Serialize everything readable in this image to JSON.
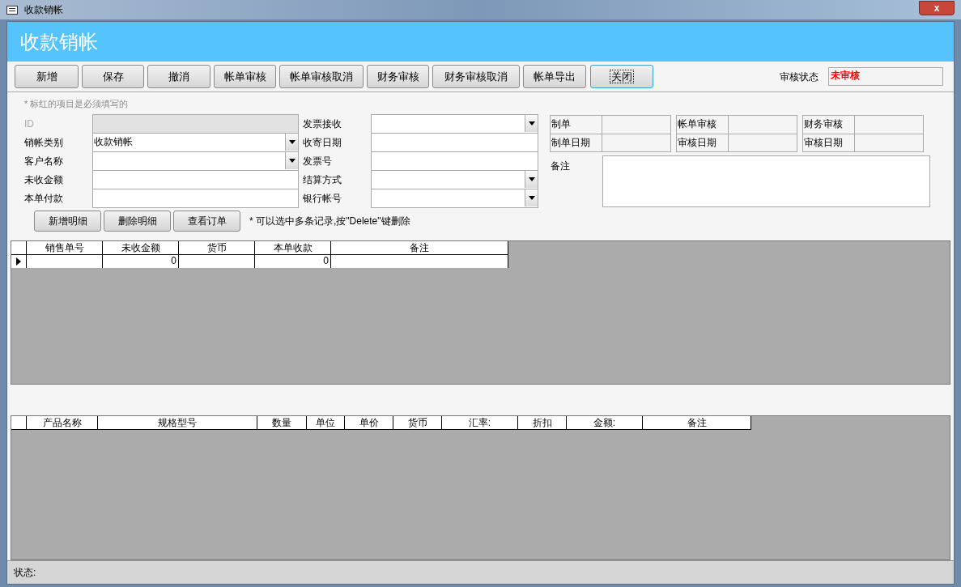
{
  "window": {
    "title": "收款销帐",
    "close": "x"
  },
  "header": {
    "title": "收款销帐"
  },
  "toolbar": {
    "buttons": [
      {
        "label": "新增",
        "focused": false
      },
      {
        "label": "保存",
        "focused": false
      },
      {
        "label": "撤消",
        "focused": false
      },
      {
        "label": "帐单审核",
        "focused": false
      },
      {
        "label": "帐单审核取消",
        "focused": false
      },
      {
        "label": "财务审核",
        "focused": false
      },
      {
        "label": "财务审核取消",
        "focused": false
      },
      {
        "label": "帐单导出",
        "focused": false
      },
      {
        "label": "关闭",
        "focused": true
      }
    ],
    "status_label": "审核状态",
    "status_value": "未审核"
  },
  "form": {
    "note": "* 标红的项目是必须填写的",
    "left_fields": [
      {
        "label": "ID",
        "kind": "text",
        "disabled": true
      },
      {
        "label": "销帐类别",
        "kind": "combo",
        "value": "收款销帐",
        "disabled": false
      },
      {
        "label": "客户名称",
        "kind": "combo",
        "disabled": false
      },
      {
        "label": "未收金额",
        "kind": "text",
        "disabled": false
      },
      {
        "label": "本单付款",
        "kind": "text",
        "disabled": false
      }
    ],
    "middle_fields": [
      {
        "label": "发票接收",
        "kind": "combo",
        "disabled": false
      },
      {
        "label": "收寄日期",
        "kind": "text",
        "disabled": false
      },
      {
        "label": "发票号",
        "kind": "text",
        "disabled": false
      },
      {
        "label": "结算方式",
        "kind": "combo",
        "disabled": false
      },
      {
        "label": "银行帐号",
        "kind": "combo",
        "disabled": false
      }
    ],
    "audit_groups": [
      [
        {
          "label": "制单"
        },
        {
          "label": "制单日期"
        }
      ],
      [
        {
          "label": "帐单审核"
        },
        {
          "label": "审核日期"
        }
      ],
      [
        {
          "label": "财务审核"
        },
        {
          "label": "审核日期"
        }
      ]
    ],
    "remarks_label": "备注",
    "detail_buttons": [
      "新增明细",
      "删除明细",
      "查看订单"
    ],
    "detail_hint": "* 可以选中多条记录,按\"Delete\"键删除"
  },
  "payment_table": {
    "columns": [
      "销售单号",
      "未收金额",
      "货币",
      "本单收款",
      "备注"
    ],
    "rows": [
      {
        "selected": true,
        "cells": [
          "",
          "0",
          "",
          "0",
          ""
        ]
      }
    ]
  },
  "product_table": {
    "columns": [
      "产品名称",
      "规格型号",
      "数量",
      "单位",
      "单价",
      "货币",
      "汇率:",
      "折扣",
      "金额:",
      "备注"
    ]
  },
  "status_bar": {
    "label": "状态:"
  }
}
